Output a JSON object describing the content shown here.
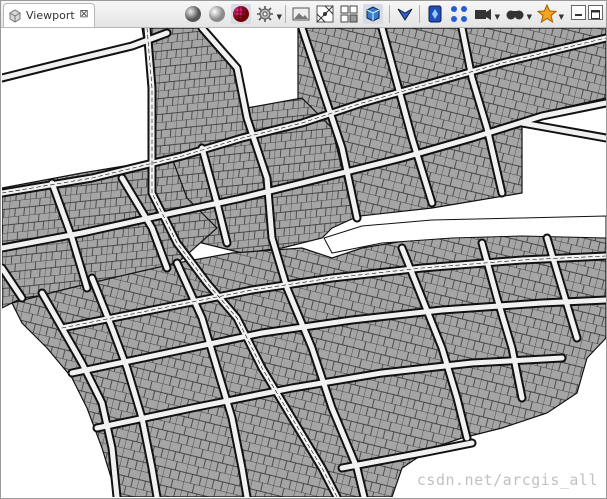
{
  "tab": {
    "label": "Viewport",
    "close_glyph": "⊠"
  },
  "toolbar": {
    "items": [
      {
        "name": "shaded-sphere-icon"
      },
      {
        "name": "smooth-sphere-icon"
      },
      {
        "name": "textured-sphere-icon",
        "active": true
      },
      {
        "name": "render-settings-icon",
        "dropdown": true
      },
      {
        "name": "photo-icon"
      },
      {
        "name": "snap-grid-icon"
      },
      {
        "name": "grid-icon"
      },
      {
        "name": "cube-icon"
      },
      {
        "name": "select-icon"
      },
      {
        "name": "camera-bookmark-icon"
      },
      {
        "name": "nodes-icon"
      },
      {
        "name": "camera-icon",
        "dropdown": true
      },
      {
        "name": "binoculars-icon",
        "dropdown": true
      },
      {
        "name": "star-icon",
        "dropdown": true
      }
    ]
  },
  "window_controls": [
    "minimize-icon",
    "maximize-icon"
  ],
  "watermark": "csdn.net/arcgis_all",
  "colors": {
    "block": "#a5a5a5",
    "road": "#f1f1f1",
    "edge": "#111111",
    "background": "#ffffff"
  }
}
